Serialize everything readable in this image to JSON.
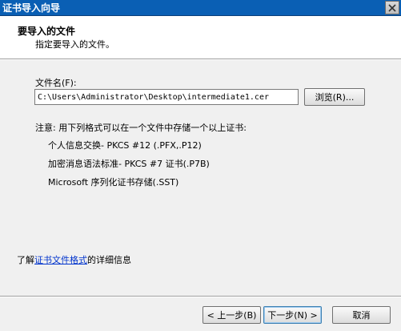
{
  "window": {
    "title": "证书导入向导",
    "close_icon": "close-icon"
  },
  "header": {
    "title": "要导入的文件",
    "subtitle": "指定要导入的文件。"
  },
  "file": {
    "label": "文件名(F):",
    "value": "C:\\Users\\Administrator\\Desktop\\intermediate1.cer",
    "browse_label": "浏览(R)..."
  },
  "note": "注意: 用下列格式可以在一个文件中存储一个以上证书:",
  "formats": [
    "个人信息交换- PKCS #12 (.PFX,.P12)",
    "加密消息语法标准- PKCS #7 证书(.P7B)",
    "Microsoft 序列化证书存储(.SST)"
  ],
  "learn_more": {
    "prefix": "了解",
    "link": "证书文件格式",
    "suffix": "的详细信息"
  },
  "buttons": {
    "back": "< 上一步(B)",
    "next": "下一步(N) >",
    "cancel": "取消"
  }
}
